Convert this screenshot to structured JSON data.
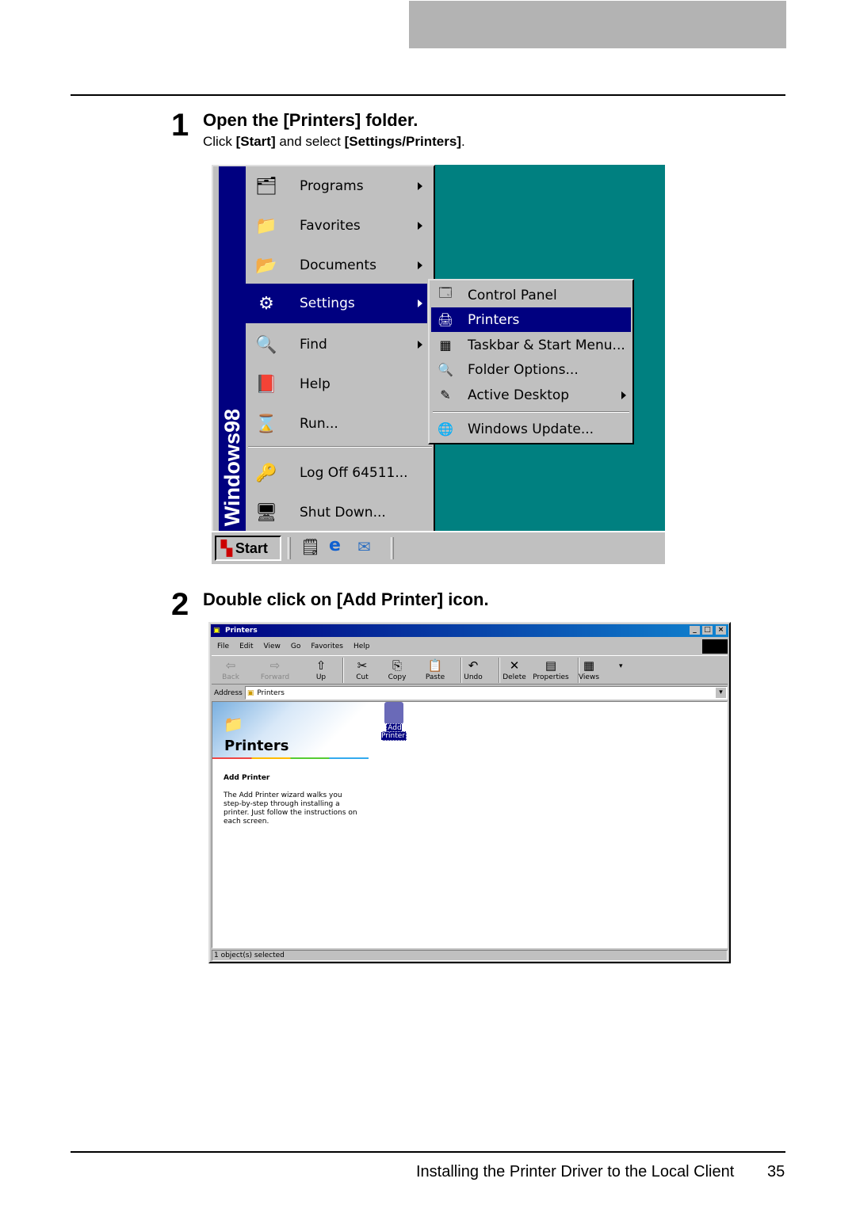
{
  "step1": {
    "number": "1",
    "title": "Open the [Printers] folder.",
    "sub_pre": "Click ",
    "sub_b1": "[Start]",
    "sub_mid": " and select ",
    "sub_b2": "[Settings/Printers]",
    "sub_post": "."
  },
  "step2": {
    "number": "2",
    "title": "Double click on [Add Printer] icon."
  },
  "start_menu": {
    "banner": "Windows98",
    "items": [
      {
        "label": "Programs",
        "icon": "programs-icon",
        "glyph": "🗂",
        "submenu": true
      },
      {
        "label": "Favorites",
        "icon": "favorites-icon",
        "glyph": "📁",
        "submenu": true
      },
      {
        "label": "Documents",
        "icon": "documents-icon",
        "glyph": "📂",
        "submenu": true
      },
      {
        "label": "Settings",
        "icon": "settings-icon",
        "glyph": "⚙",
        "submenu": true,
        "highlighted": true
      },
      {
        "label": "Find",
        "icon": "find-icon",
        "glyph": "🔍",
        "submenu": true
      },
      {
        "label": "Help",
        "icon": "help-icon",
        "glyph": "📕",
        "submenu": false
      },
      {
        "label": "Run...",
        "icon": "run-icon",
        "glyph": "⌛",
        "submenu": false
      },
      {
        "label": "Log Off 64511...",
        "icon": "key-icon",
        "glyph": "🔑",
        "submenu": false
      },
      {
        "label": "Shut Down...",
        "icon": "monitor-icon",
        "glyph": "🖥",
        "submenu": false
      }
    ],
    "settings_submenu": [
      {
        "label": "Control Panel",
        "icon": "control-panel-icon",
        "glyph": "🗔"
      },
      {
        "label": "Printers",
        "icon": "printers-icon",
        "glyph": "🖨",
        "highlighted": true
      },
      {
        "label": "Taskbar & Start Menu...",
        "icon": "taskbar-icon",
        "glyph": "▦"
      },
      {
        "label": "Folder Options...",
        "icon": "folder-options-icon",
        "glyph": "🔍"
      },
      {
        "label": "Active Desktop",
        "icon": "active-desktop-icon",
        "glyph": "✎",
        "submenu": true
      },
      {
        "label": "Windows Update...",
        "icon": "windows-update-icon",
        "glyph": "🌐"
      }
    ],
    "taskbar": {
      "start_label": "Start"
    },
    "desktop_color": "#008080",
    "highlight_color": "#000080"
  },
  "explorer": {
    "title": "Printers",
    "menu": [
      "File",
      "Edit",
      "View",
      "Go",
      "Favorites",
      "Help"
    ],
    "toolbar": [
      {
        "label": "Back",
        "glyph": "⇦",
        "disabled": true
      },
      {
        "label": "Forward",
        "glyph": "⇨",
        "disabled": true
      },
      {
        "label": "Up",
        "glyph": "⇧"
      },
      {
        "label": "Cut",
        "glyph": "✂"
      },
      {
        "label": "Copy",
        "glyph": "⎘"
      },
      {
        "label": "Paste",
        "glyph": "📋"
      },
      {
        "label": "Undo",
        "glyph": "↶"
      },
      {
        "label": "Delete",
        "glyph": "✕"
      },
      {
        "label": "Properties",
        "glyph": "▤"
      },
      {
        "label": "Views",
        "glyph": "▦"
      }
    ],
    "address_label": "Address",
    "address_value": "Printers",
    "panel_title": "Printers",
    "panel_subtitle": "Add Printer",
    "panel_desc": "The Add Printer wizard walks you step-by-step through installing a printer. Just follow the instructions on each screen.",
    "icon_label": "Add Printer",
    "status": "1 object(s) selected"
  },
  "footer": {
    "text": "Installing the Printer Driver to the Local Client",
    "page": "35"
  }
}
